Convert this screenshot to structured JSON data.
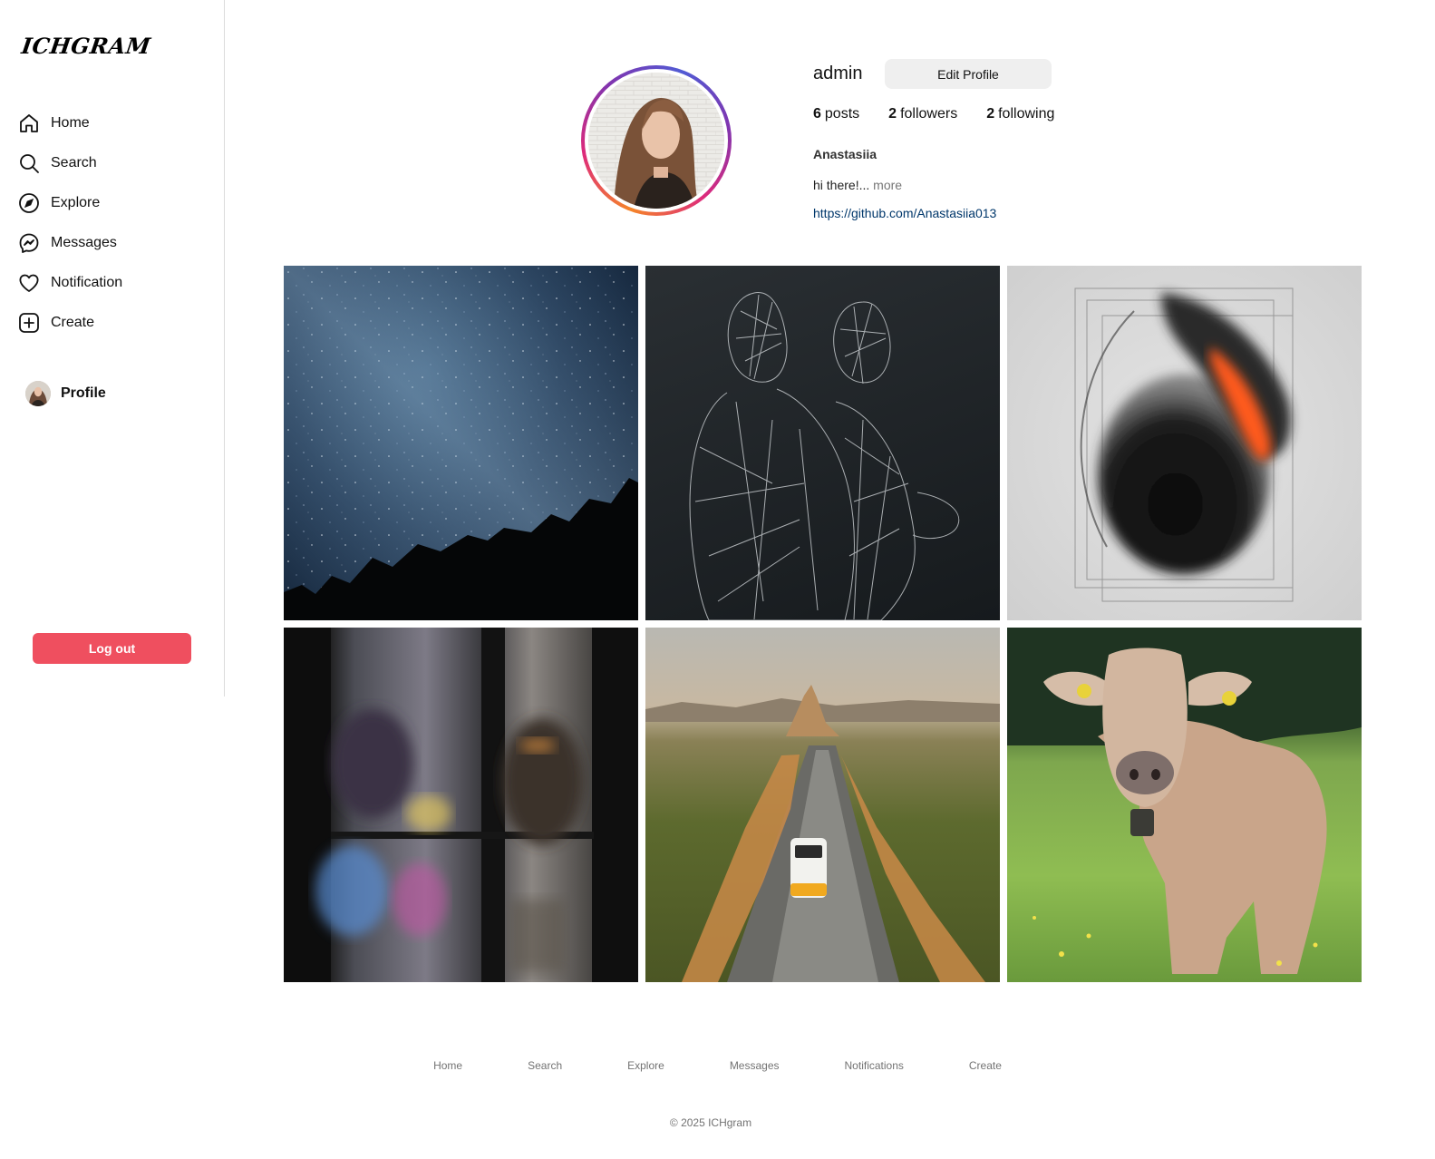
{
  "app": {
    "logo": "ICHGRAM"
  },
  "sidebar": {
    "items": [
      {
        "label": "Home",
        "icon": "home-icon"
      },
      {
        "label": "Search",
        "icon": "search-icon"
      },
      {
        "label": "Explore",
        "icon": "compass-icon"
      },
      {
        "label": "Messages",
        "icon": "messenger-icon"
      },
      {
        "label": "Notification",
        "icon": "heart-icon"
      },
      {
        "label": "Create",
        "icon": "plus-square-icon"
      }
    ],
    "profile_label": "Profile",
    "logout_label": "Log out"
  },
  "profile": {
    "username": "admin",
    "edit_button": "Edit Profile",
    "posts_count": "6",
    "posts_label": "posts",
    "followers_count": "2",
    "followers_label": "followers",
    "following_count": "2",
    "following_label": "following",
    "full_name": "Anastasiia",
    "bio": "hi there!...",
    "more_label": "more",
    "link": "https://github.com/Anastasiia013"
  },
  "posts": [
    {
      "subject": "milky-way-night-sky"
    },
    {
      "subject": "wireframe-figures-embrace"
    },
    {
      "subject": "abstract-orange-black-sphere"
    },
    {
      "subject": "silhouettes-behind-frosted-glass"
    },
    {
      "subject": "van-on-desert-road"
    },
    {
      "subject": "cow-in-meadow"
    }
  ],
  "footer": {
    "links": [
      "Home",
      "Search",
      "Explore",
      "Messages",
      "Notifications",
      "Create"
    ],
    "copyright": "© 2025 ICHgram"
  },
  "colors": {
    "logout_bg": "#ef4f5f",
    "link": "#00376b",
    "edit_bg": "#efefef",
    "border": "#dbdbdb"
  }
}
